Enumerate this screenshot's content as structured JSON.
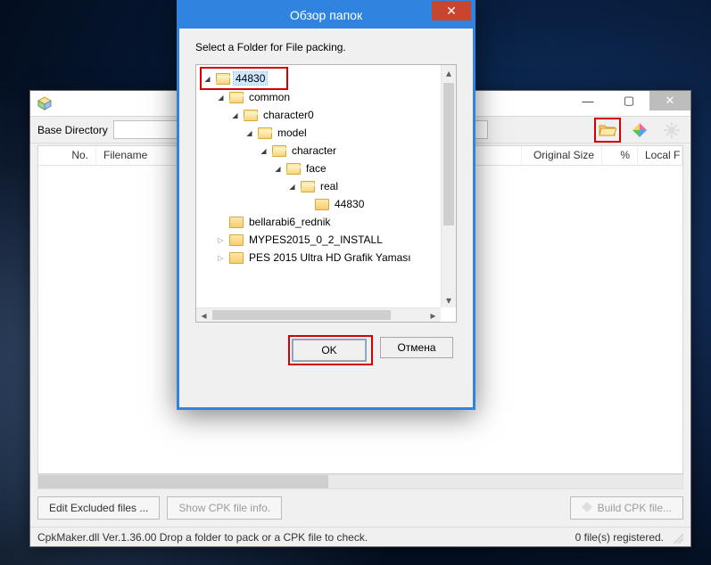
{
  "app": {
    "base_directory_label": "Base Directory",
    "columns": {
      "no": "No.",
      "filename": "Filename",
      "original_size": "Original Size",
      "percent": "%",
      "local": "Local F"
    },
    "buttons": {
      "edit_excluded": "Edit Excluded files ...",
      "show_info": "Show CPK file info.",
      "build": "Build CPK file..."
    },
    "status_left": "CpkMaker.dll Ver.1.36.00  Drop a folder to pack or a CPK file to check.",
    "status_right": "0 file(s) registered."
  },
  "dialog": {
    "title": "Обзор папок",
    "instruction": "Select a Folder for File packing.",
    "ok": "OK",
    "cancel": "Отмена",
    "tree": [
      {
        "depth": 0,
        "toggle": "▾",
        "label": "44830",
        "selected": true,
        "highlighted": true,
        "open": true
      },
      {
        "depth": 1,
        "toggle": "▾",
        "label": "common",
        "open": true
      },
      {
        "depth": 2,
        "toggle": "▾",
        "label": "character0",
        "open": true
      },
      {
        "depth": 3,
        "toggle": "▾",
        "label": "model",
        "open": true
      },
      {
        "depth": 4,
        "toggle": "▾",
        "label": "character",
        "open": true
      },
      {
        "depth": 5,
        "toggle": "▾",
        "label": "face",
        "open": true
      },
      {
        "depth": 6,
        "toggle": "▾",
        "label": "real",
        "open": true
      },
      {
        "depth": 7,
        "toggle": "",
        "label": "44830"
      },
      {
        "depth": 1,
        "toggle": "",
        "label": "bellarabi6_rednik"
      },
      {
        "depth": 1,
        "toggle": "▸",
        "label": "MYPES2015_0_2_INSTALL"
      },
      {
        "depth": 1,
        "toggle": "▸",
        "label": "PES 2015 Ultra HD Grafik Yaması"
      }
    ]
  }
}
